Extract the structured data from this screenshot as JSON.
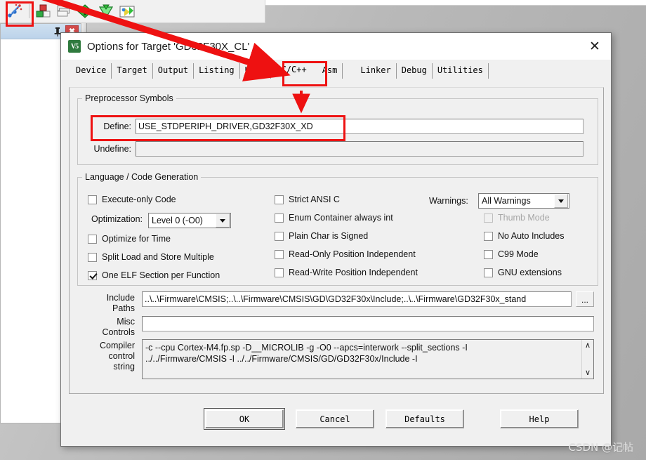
{
  "ide": {
    "toolbar_icons": [
      {
        "name": "build-target-wand-icon"
      },
      {
        "name": "manage-components-icon"
      },
      {
        "name": "multi-project-icon"
      },
      {
        "name": "green-diamond-icon"
      },
      {
        "name": "batch-build-icon"
      },
      {
        "name": "pack-installer-icon"
      }
    ],
    "panel": {
      "pin_label": "⚑",
      "close_label": "✖"
    }
  },
  "dialog": {
    "icon_label": "V5",
    "title": "Options for Target 'GD32F30X_CL'",
    "close_label": "✕",
    "tabs": [
      {
        "label": "Device",
        "active": false
      },
      {
        "label": "Target",
        "active": false
      },
      {
        "label": "Output",
        "active": false
      },
      {
        "label": "Listing",
        "active": false
      },
      {
        "label": "User",
        "active": false
      },
      {
        "label": "C/C++",
        "active": true
      },
      {
        "label": "Asm",
        "active": false
      },
      {
        "label": "Linker",
        "active": false
      },
      {
        "label": "Debug",
        "active": false
      },
      {
        "label": "Utilities",
        "active": false
      }
    ],
    "preprocessor": {
      "legend": "Preprocessor Symbols",
      "define_label": "Define:",
      "define_value": "USE_STDPERIPH_DRIVER,GD32F30X_XD",
      "undefine_label": "Undefine:",
      "undefine_value": ""
    },
    "language": {
      "legend": "Language / Code Generation",
      "col1": [
        {
          "label": "Execute-only Code",
          "checked": false,
          "disabled": false
        },
        {
          "label": "Optimize for Time",
          "checked": false,
          "disabled": false
        },
        {
          "label": "Split Load and Store Multiple",
          "checked": false,
          "disabled": false
        },
        {
          "label": "One ELF Section per Function",
          "checked": true,
          "disabled": false
        }
      ],
      "optimization_label": "Optimization:",
      "optimization_value": "Level 0 (-O0)",
      "col2": [
        {
          "label": "Strict ANSI C",
          "checked": false,
          "disabled": false
        },
        {
          "label": "Enum Container always int",
          "checked": false,
          "disabled": false
        },
        {
          "label": "Plain Char is Signed",
          "checked": false,
          "disabled": false
        },
        {
          "label": "Read-Only Position Independent",
          "checked": false,
          "disabled": false
        },
        {
          "label": "Read-Write Position Independent",
          "checked": false,
          "disabled": false
        }
      ],
      "warnings_label": "Warnings:",
      "warnings_value": "All Warnings",
      "col3": [
        {
          "label": "Thumb Mode",
          "checked": false,
          "disabled": true
        },
        {
          "label": "No Auto Includes",
          "checked": false,
          "disabled": false
        },
        {
          "label": "C99 Mode",
          "checked": false,
          "disabled": false
        },
        {
          "label": "GNU extensions",
          "checked": false,
          "disabled": false
        }
      ]
    },
    "paths": {
      "include_label": "Include\nPaths",
      "include_value": "..\\..\\Firmware\\CMSIS;..\\..\\Firmware\\CMSIS\\GD\\GD32F30x\\Include;..\\..\\Firmware\\GD32F30x_stand",
      "include_browse_label": "...",
      "misc_label": "Misc\nControls",
      "misc_value": "",
      "compiler_label": "Compiler\ncontrol\nstring",
      "compiler_value": "-c --cpu Cortex-M4.fp.sp -D__MICROLIB -g -O0 --apcs=interwork --split_sections -I\n../../Firmware/CMSIS -I ../../Firmware/CMSIS/GD/GD32F30x/Include -I",
      "scroll_up": "∧",
      "scroll_down": "∨"
    },
    "buttons": {
      "ok": "OK",
      "cancel": "Cancel",
      "defaults": "Defaults",
      "help": "Help"
    }
  },
  "annotations": {
    "highlight_color": "#ee1111",
    "arrow_toolbar_to_tab": "arrow from toolbar build button to C/C++ tab",
    "arrow_tab_to_define": "arrow from C/C++ tab down to Define field"
  },
  "watermark": "CSDN @记帖"
}
